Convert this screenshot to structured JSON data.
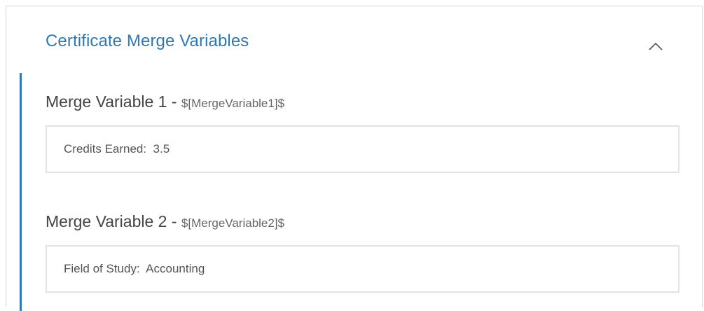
{
  "panel": {
    "title": "Certificate Merge Variables",
    "toggle_icon": "chevron-up-icon",
    "accent_color": "#2f79b3",
    "expanded": true
  },
  "fields": [
    {
      "label": "Merge Variable 1",
      "separator": " - ",
      "token": "$[MergeVariable1]$",
      "value": "Credits Earned:  3.5"
    },
    {
      "label": "Merge Variable 2",
      "separator": " - ",
      "token": "$[MergeVariable2]$",
      "value": "Field of Study:  Accounting"
    }
  ]
}
